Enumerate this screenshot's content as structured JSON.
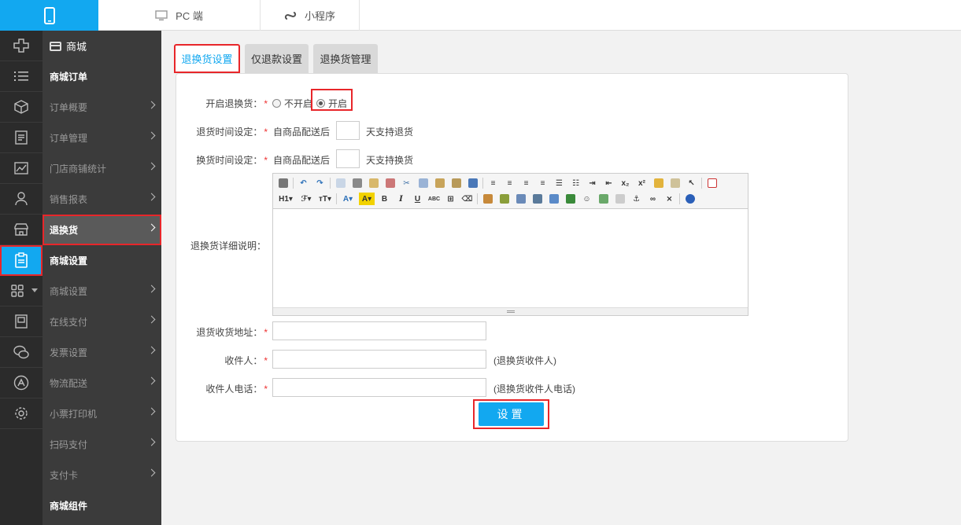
{
  "topbar": {
    "mobile_icon": "mobile-phone-icon",
    "pc_label": "PC 端",
    "pc_icon": "monitor-icon",
    "mini_label": "小程序",
    "mini_icon": "mini-program-icon"
  },
  "rail": {
    "icons": [
      "apps-icon",
      "list-icon",
      "cube-icon",
      "document-icon",
      "chart-icon",
      "user-icon",
      "store-icon",
      "clipboard-icon",
      "grid-icon",
      "book-icon",
      "wechat-icon",
      "app-store-icon",
      "gear-icon"
    ]
  },
  "submenu": {
    "top_label": "商城",
    "order_section": "商城订单",
    "order_items": [
      "订单概要",
      "订单管理",
      "门店商铺统计",
      "销售报表"
    ],
    "return_item": "退换货",
    "settings_section": "商城设置",
    "settings_items": [
      "商城设置",
      "在线支付",
      "发票设置",
      "物流配送",
      "小票打印机",
      "扫码支付",
      "支付卡"
    ],
    "component_section": "商城组件"
  },
  "tabs": {
    "t1": "退换货设置",
    "t2": "仅退款设置",
    "t3": "退换货管理"
  },
  "form": {
    "enable_label": "开启退换货：",
    "opt_off": "不开启",
    "opt_on": "开启",
    "return_time_label": "退货时间设定：",
    "exchange_time_label": "换货时间设定：",
    "from_delivery": "自商品配送后",
    "return_suffix": "天支持退货",
    "exchange_suffix": "天支持换货",
    "detail_label": "退换货详细说明：",
    "address_label": "退货收货地址：",
    "receiver_label": "收件人：",
    "receiver_hint": "(退换货收件人)",
    "phone_label": "收件人电话：",
    "phone_hint": "(退换货收件人电话)",
    "required_mark": "*",
    "submit": "设置"
  },
  "colors": {
    "accent": "#12a8f0",
    "highlight": "#e8262a",
    "sidebar": "#2b2b2b",
    "submenu": "#3b3b3b"
  }
}
